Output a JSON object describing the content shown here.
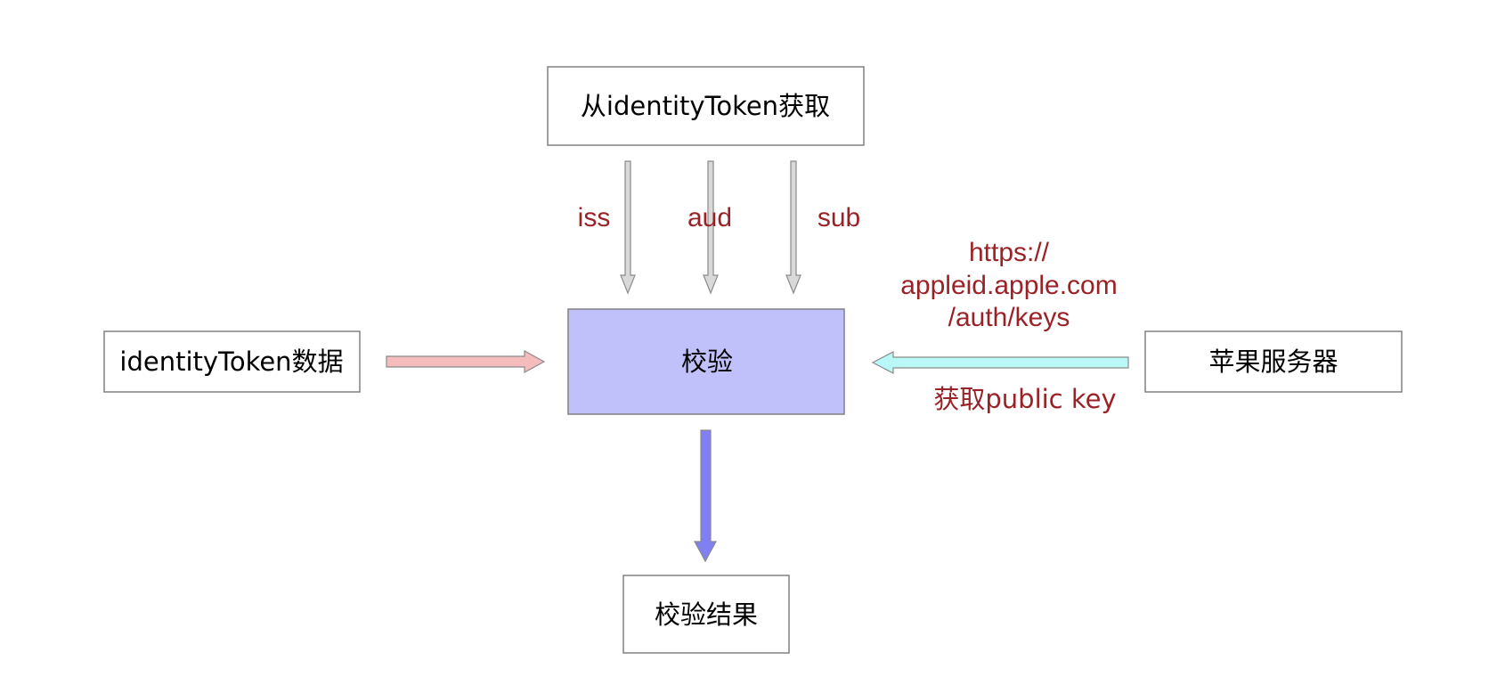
{
  "nodes": {
    "source": {
      "label": "从identityToken获取"
    },
    "input": {
      "label": "identityToken数据"
    },
    "verify": {
      "label": "校验",
      "fill": "#c0c0fa"
    },
    "apple_server": {
      "label": "苹果服务器"
    },
    "result": {
      "label": "校验结果"
    }
  },
  "edges": {
    "iss": {
      "label": "iss"
    },
    "aud": {
      "label": "aud"
    },
    "sub": {
      "label": "sub"
    },
    "input_to_verify": {
      "color": "#f4bcbc"
    },
    "apple_to_verify": {
      "label_url_lines": [
        "https://",
        "appleid.apple.com",
        "/auth/keys"
      ],
      "label_action": "获取public key",
      "color": "#b8f8f6"
    },
    "verify_to_result": {
      "color": "#8080f2"
    }
  },
  "colors": {
    "edge_label": "#9a2226",
    "node_border": "#808080",
    "gray_arrow": "#d9d9d9"
  }
}
